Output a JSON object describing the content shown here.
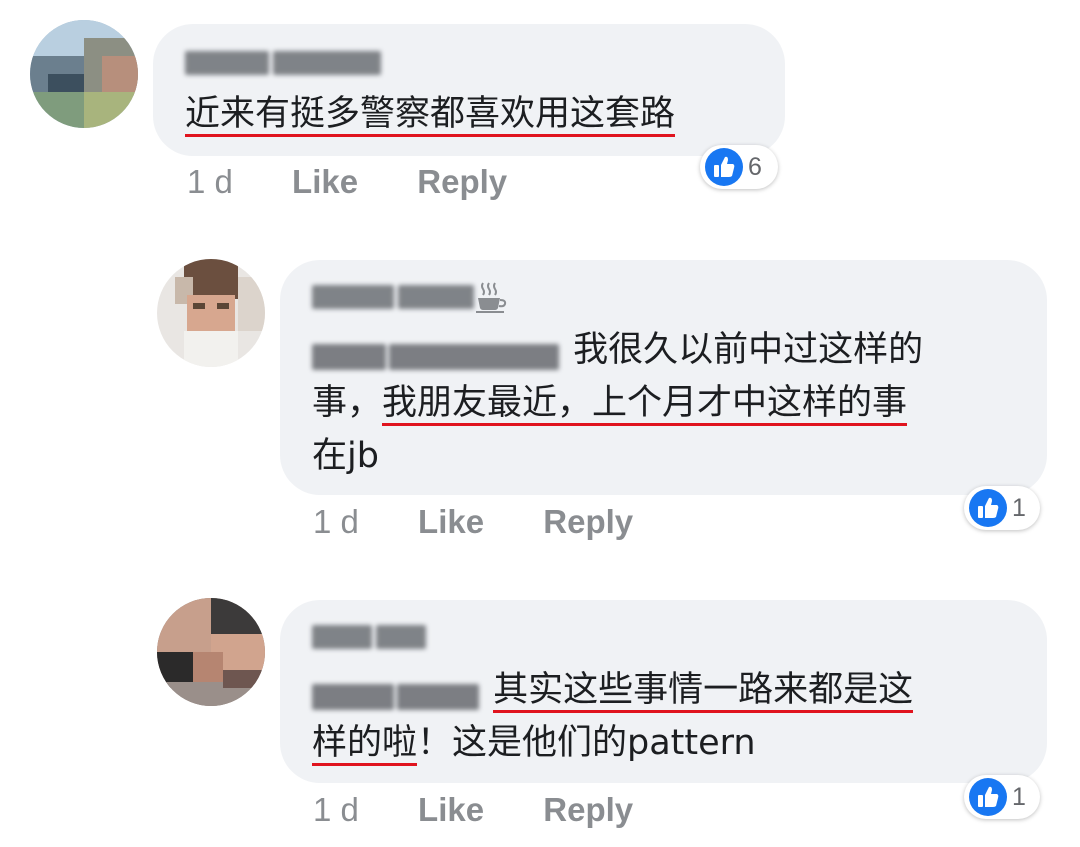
{
  "comments": [
    {
      "text": "近来有挺多警察都喜欢用这套路",
      "time": "1 d",
      "like_label": "Like",
      "reply_label": "Reply",
      "reaction_count": "6"
    },
    {
      "text_plain_1": "我很久以前中过这样的",
      "text_plain_2": "事，",
      "text_underlined": "我朋友最近，上个月才中这样的事",
      "text_plain_3": "在jb",
      "time": "1 d",
      "like_label": "Like",
      "reply_label": "Reply",
      "reaction_count": "1"
    },
    {
      "text_underlined_1": "其实这些事情一路来都是这",
      "text_underlined_2": "样的啦",
      "text_plain": "！这是他们的pattern",
      "time": "1 d",
      "like_label": "Like",
      "reply_label": "Reply",
      "reaction_count": "1"
    }
  ],
  "colors": {
    "bubble": "#f0f2f5",
    "meta_text": "#8a8d91",
    "like_blue": "#1877f2",
    "underline_red": "#e0141e"
  },
  "icons": [
    "like-reaction-icon",
    "coffee-cup-icon"
  ]
}
